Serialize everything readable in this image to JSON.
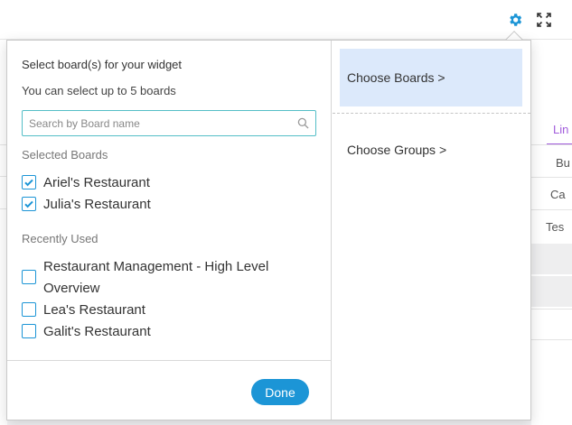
{
  "header": {
    "settings_icon": "gear-icon",
    "expand_icon": "expand-icon",
    "accent_color": "#1c95d6"
  },
  "background": {
    "tab_label": "Lin",
    "cells": [
      "Bu",
      "Ca",
      "Tes"
    ]
  },
  "popover": {
    "title": "Select board(s) for your widget",
    "subtitle": "You can select up to 5 boards",
    "search": {
      "placeholder": "Search by Board name",
      "value": ""
    },
    "selected_label": "Selected Boards",
    "selected_boards": [
      {
        "label": "Ariel's Restaurant",
        "checked": true
      },
      {
        "label": "Julia's Restaurant",
        "checked": true
      }
    ],
    "recent_label": "Recently Used",
    "recent_boards": [
      {
        "label": "Restaurant Management - High Level Overview",
        "checked": false
      },
      {
        "label": "Lea's Restaurant",
        "checked": false
      },
      {
        "label": "Galit's Restaurant",
        "checked": false
      }
    ],
    "done_label": "Done",
    "steps": {
      "choose_boards": "Choose Boards >",
      "choose_groups": "Choose Groups >"
    }
  }
}
